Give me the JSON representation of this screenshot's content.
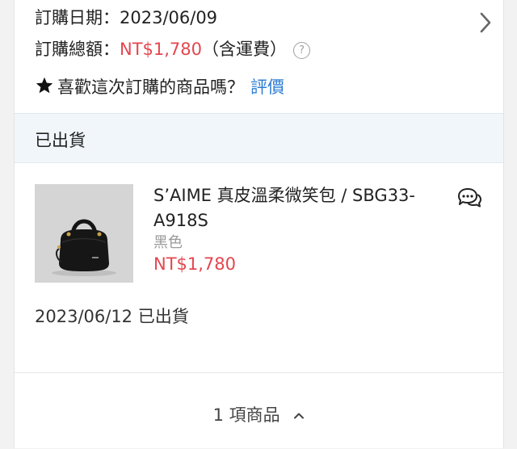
{
  "order": {
    "date_label": "訂購日期：",
    "date_value": "2023/06/09",
    "total_label": "訂購總額：",
    "total_value": "NT$1,780",
    "total_note": "（含運費）",
    "help_glyph": "?",
    "review_prompt": "喜歡這次訂購的商品嗎？",
    "review_link": "評價"
  },
  "status": {
    "label": "已出貨"
  },
  "product": {
    "name": "S’AIME 真皮溫柔微笑包 / SBG33-A918S",
    "variant": "黑色",
    "price": "NT$1,780",
    "shipped_info": "2023/06/12 已出貨"
  },
  "footer": {
    "item_count": "1 項商品"
  },
  "colors": {
    "price": "#e4464f",
    "link": "#2d7dd2",
    "status_bg": "#f1f6fb"
  },
  "icons": [
    "chevron-right-icon",
    "help-icon",
    "star-icon",
    "chat-icon",
    "chevron-up-icon"
  ]
}
